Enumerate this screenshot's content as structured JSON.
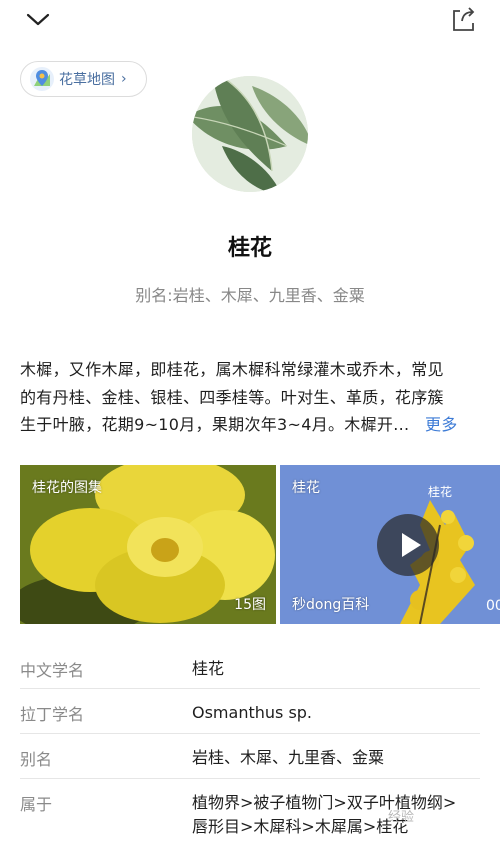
{
  "header": {
    "back_icon": "chevron-down-icon",
    "share_icon": "share-icon"
  },
  "map_chip": {
    "label": "花草地图",
    "arrow": "›",
    "icon": "map-pin-icon"
  },
  "plant": {
    "name": "桂花",
    "alias_line": "别名:岩桂、木犀、九里香、金粟"
  },
  "description": {
    "text_line1": "木樨，又作木犀，即桂花，属木樨科常绿灌木或乔木，常见",
    "text_line2": "的有丹桂、金桂、银桂、四季桂等。叶对生、革质，花序簇",
    "text_line3": "生于叶腋，花期9~10月，果期次年3~4月。木樨开...",
    "more": "更多"
  },
  "gallery": {
    "title": "桂花的图集",
    "count": "15图"
  },
  "video": {
    "title": "桂花",
    "caption": "桂花",
    "source": "秒dong百科",
    "time_fragment": "00"
  },
  "info_rows": [
    {
      "key": "中文学名",
      "value": "桂花"
    },
    {
      "key": "拉丁学名",
      "value": "Osmanthus  sp."
    },
    {
      "key": "别名",
      "value": "岩桂、木犀、九里香、金粟"
    },
    {
      "key": "属于",
      "value_line1": "植物界>被子植物门>双子叶植物纲>",
      "value_line2": "唇形目>木犀科>木犀属>桂花"
    }
  ],
  "watermark": "经验",
  "colors": {
    "link": "#3d7bd6",
    "chip_text": "#4a6fa0",
    "muted": "#888888"
  }
}
